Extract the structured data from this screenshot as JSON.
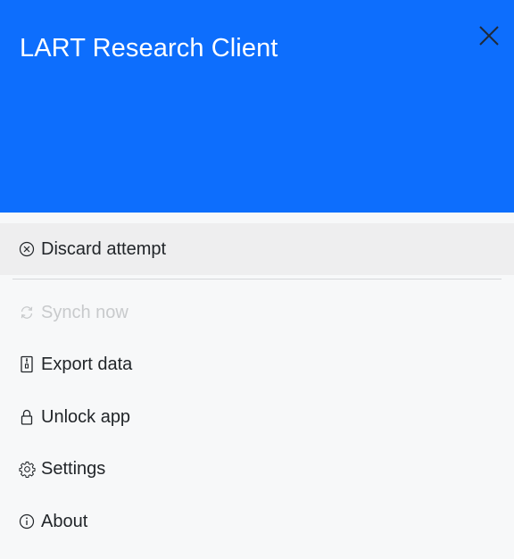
{
  "header": {
    "title": "LART Research Client",
    "background_color": "#0d6efd",
    "close_icon": "close-icon"
  },
  "menu": {
    "items": [
      {
        "label": "Discard attempt",
        "icon": "circle-x-icon",
        "state": "highlighted"
      },
      {
        "label": "Synch now",
        "icon": "sync-icon",
        "state": "disabled"
      },
      {
        "label": "Export data",
        "icon": "zip-file-icon",
        "state": "normal"
      },
      {
        "label": "Unlock app",
        "icon": "lock-icon",
        "state": "normal"
      },
      {
        "label": "Settings",
        "icon": "gear-icon",
        "state": "normal"
      },
      {
        "label": "About",
        "icon": "info-icon",
        "state": "normal"
      }
    ]
  }
}
